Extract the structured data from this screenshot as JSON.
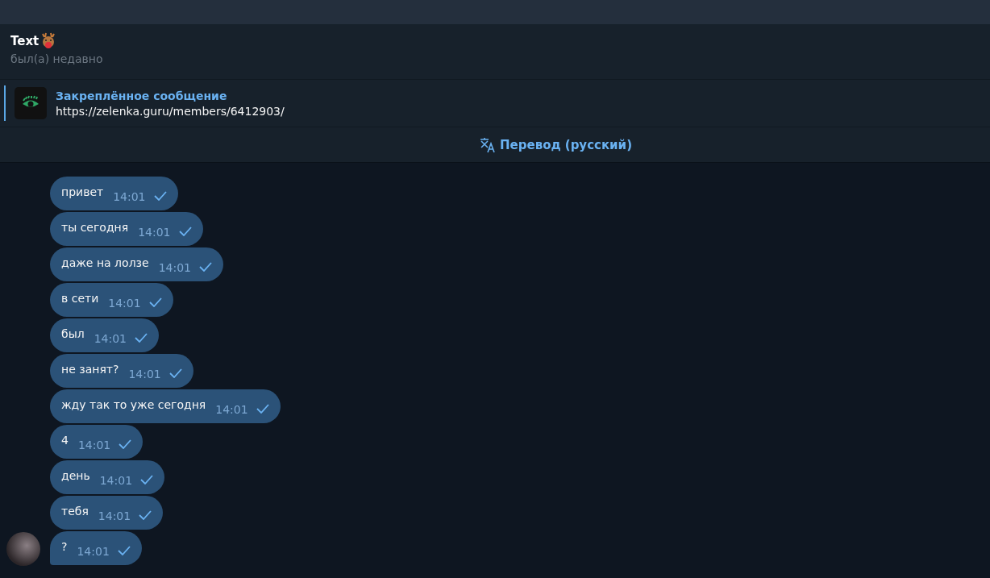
{
  "chat": {
    "name": "Text",
    "status": "был(а) недавно"
  },
  "pinned": {
    "title": "Закреплённое сообщение",
    "text": "https://zelenka.guru/members/6412903/"
  },
  "translate": {
    "label": "Перевод (русский)"
  },
  "messages": [
    {
      "text": "привет",
      "time": "14:01",
      "read": false
    },
    {
      "text": "ты сегодня",
      "time": "14:01",
      "read": false
    },
    {
      "text": "даже на лолзе",
      "time": "14:01",
      "read": false
    },
    {
      "text": "в сети",
      "time": "14:01",
      "read": false
    },
    {
      "text": "был",
      "time": "14:01",
      "read": false
    },
    {
      "text": "не занят?",
      "time": "14:01",
      "read": false
    },
    {
      "text": "жду так то уже сегодня",
      "time": "14:01",
      "read": false
    },
    {
      "text": "4",
      "time": "14:01",
      "read": false
    },
    {
      "text": "день",
      "time": "14:01",
      "read": false
    },
    {
      "text": "тебя",
      "time": "14:01",
      "read": false
    },
    {
      "text": "?",
      "time": "14:01",
      "read": false
    }
  ]
}
